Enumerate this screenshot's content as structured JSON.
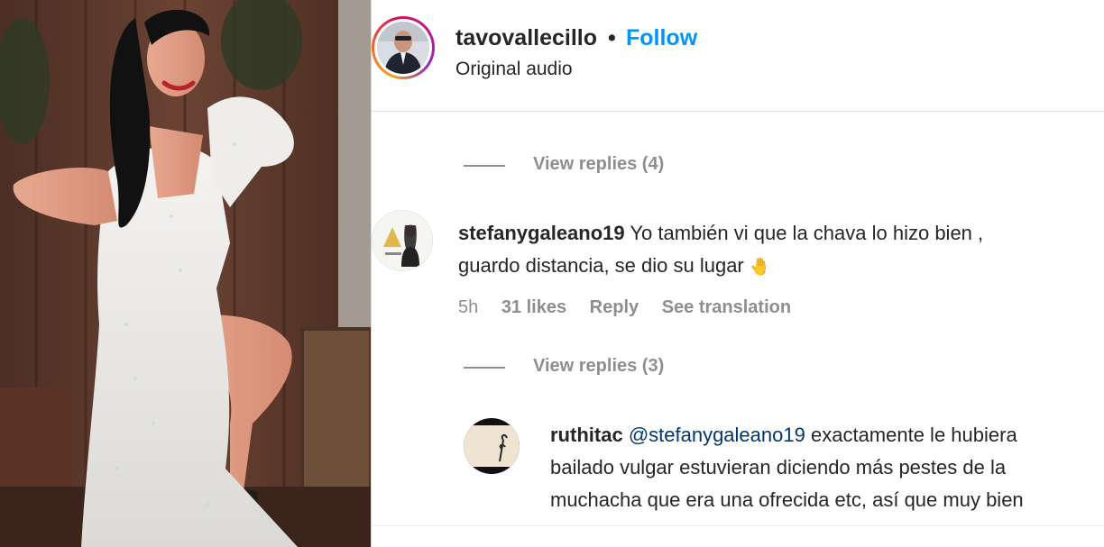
{
  "post": {
    "username": "tavovallecillo",
    "separator": "•",
    "follow_label": "Follow",
    "audio_label": "Original audio"
  },
  "thread_1": {
    "view_replies": "View replies (4)"
  },
  "comment_1": {
    "username": "stefanygaleano19",
    "line1": "Yo también vi que la chava lo hizo bien ,",
    "line2": "guardo distancia, se dio su lugar",
    "emoji": "🤚",
    "time": "5h",
    "likes": "31 likes",
    "reply_label": "Reply",
    "translate_label": "See translation",
    "view_replies": "View replies (3)"
  },
  "reply_1": {
    "username": "ruthitac",
    "mention": "@stefanygaleano19",
    "line1_rest": "exactamente le hubiera",
    "line2": "bailado vulgar estuvieran diciendo más pestes de la",
    "line3": "muchacha que era una ofrecida etc, así que muy bien"
  },
  "colors": {
    "follow_blue": "#0095f6",
    "muted_gray": "#8e8e8e",
    "text": "#262626",
    "mention": "#00376b"
  },
  "icons": [
    "hand-emoji-icon"
  ]
}
